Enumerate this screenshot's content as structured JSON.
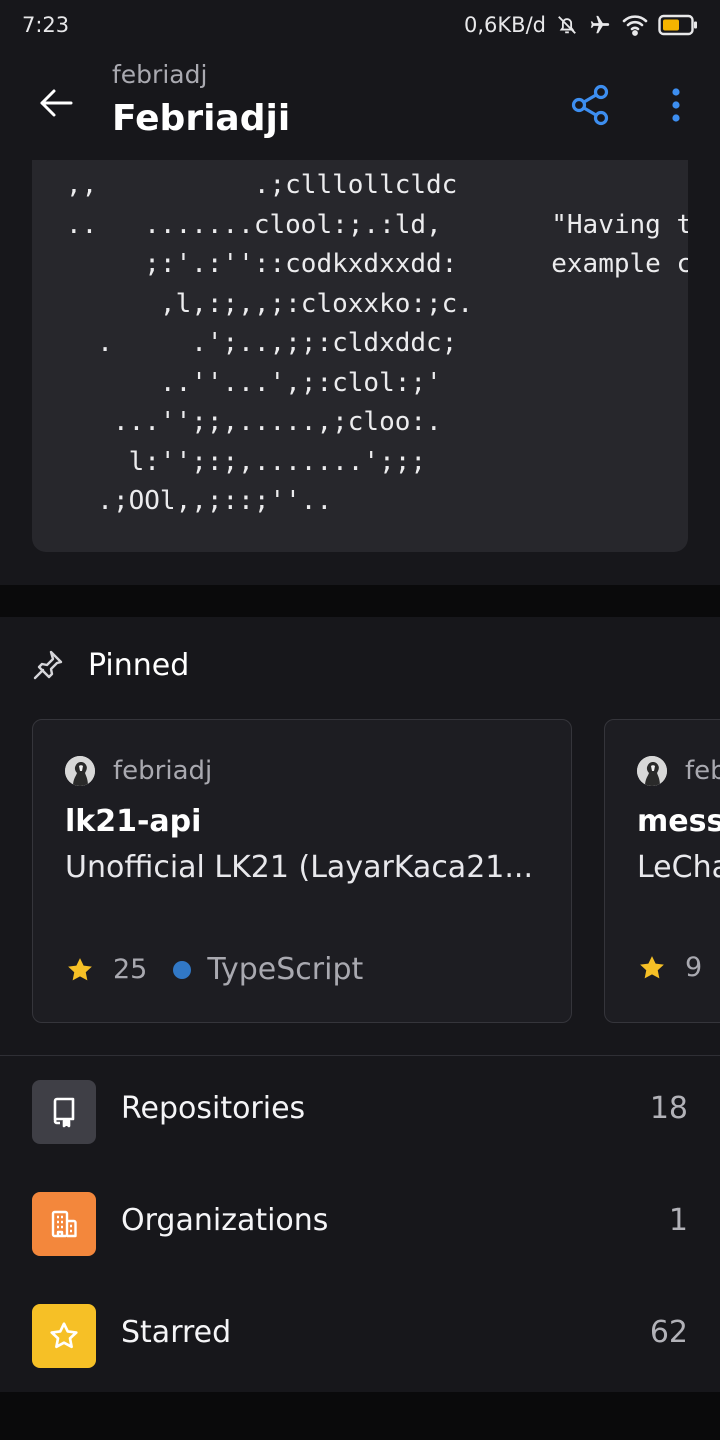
{
  "status_bar": {
    "time": "7:23",
    "network_speed": "0,6KB/d",
    "icons": [
      "bell-off-icon",
      "airplane-icon",
      "wifi-icon",
      "battery-icon"
    ],
    "battery_color": "#f5b400"
  },
  "app_bar": {
    "subtitle": "febriadj",
    "title": "Febriadji",
    "accent_color": "#3d8ef0"
  },
  "readme": {
    "ascii_art": ",,          .;clllollcldc\n..   .......clool:;.:ld,       \"Having t\n     ;:'.:''::codkxdxxdd:      example c\n      ,l,:;,,;:cloxxko:;c.\n  .     .';..,;;:cldxddc;\n      ..''...',;:clol:;'\n   ...'';;,.....,;cloo:.\n    l:'';:;,.......';;;\n  .;OOl,,;::;''.."
  },
  "pinned": {
    "title": "Pinned",
    "cards": [
      {
        "owner": "febriadj",
        "name": "lk21-api",
        "description": "Unofficial LK21 (LayarKaca21...",
        "stars": "25",
        "language": "TypeScript",
        "language_color": "#3178c6"
      },
      {
        "owner": "feb",
        "name": "mess",
        "description": "LeCha",
        "stars": "9"
      }
    ]
  },
  "menu": [
    {
      "label": "Repositories",
      "count": "18",
      "icon": "repo-icon",
      "color": "#3f3f46"
    },
    {
      "label": "Organizations",
      "count": "1",
      "icon": "organization-icon",
      "color": "#f3873c"
    },
    {
      "label": "Starred",
      "count": "62",
      "icon": "star-outline-icon",
      "color": "#f6c026"
    }
  ]
}
